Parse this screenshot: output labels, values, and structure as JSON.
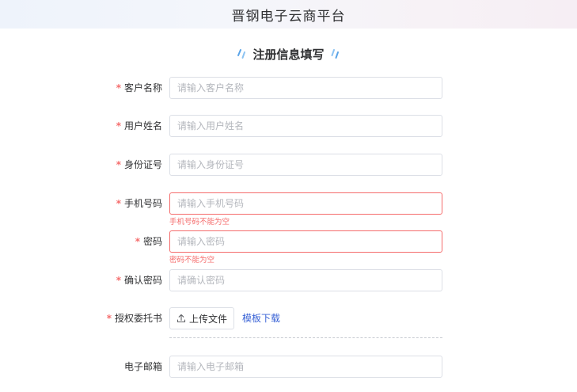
{
  "header": {
    "title": "晋钢电子云商平台"
  },
  "form": {
    "title": "注册信息填写",
    "fields": {
      "customer_name": {
        "label": "客户名称",
        "placeholder": "请输入客户名称",
        "value": ""
      },
      "user_name": {
        "label": "用户姓名",
        "placeholder": "请输入用户姓名",
        "value": ""
      },
      "id_number": {
        "label": "身份证号",
        "placeholder": "请输入身份证号",
        "value": ""
      },
      "phone": {
        "label": "手机号码",
        "placeholder": "请输入手机号码",
        "value": "",
        "error": "手机号码不能为空"
      },
      "password": {
        "label": "密码",
        "placeholder": "请输入密码",
        "value": "",
        "error": "密码不能为空"
      },
      "confirm_password": {
        "label": "确认密码",
        "placeholder": "请确认密码",
        "value": ""
      },
      "authorization": {
        "label": "授权委托书",
        "upload_label": "上传文件",
        "template_link": "模板下载"
      },
      "email": {
        "label": "电子邮箱",
        "placeholder": "请输入电子邮箱",
        "value": ""
      }
    },
    "required_mark": "*"
  },
  "colors": {
    "error": "#f56c6c",
    "link": "#3a63d6",
    "border": "#dcdfe6",
    "accent_deco": "#5aa4e8"
  },
  "icons": {
    "title_decoration": "double-slash-icon",
    "upload": "upload-icon"
  }
}
